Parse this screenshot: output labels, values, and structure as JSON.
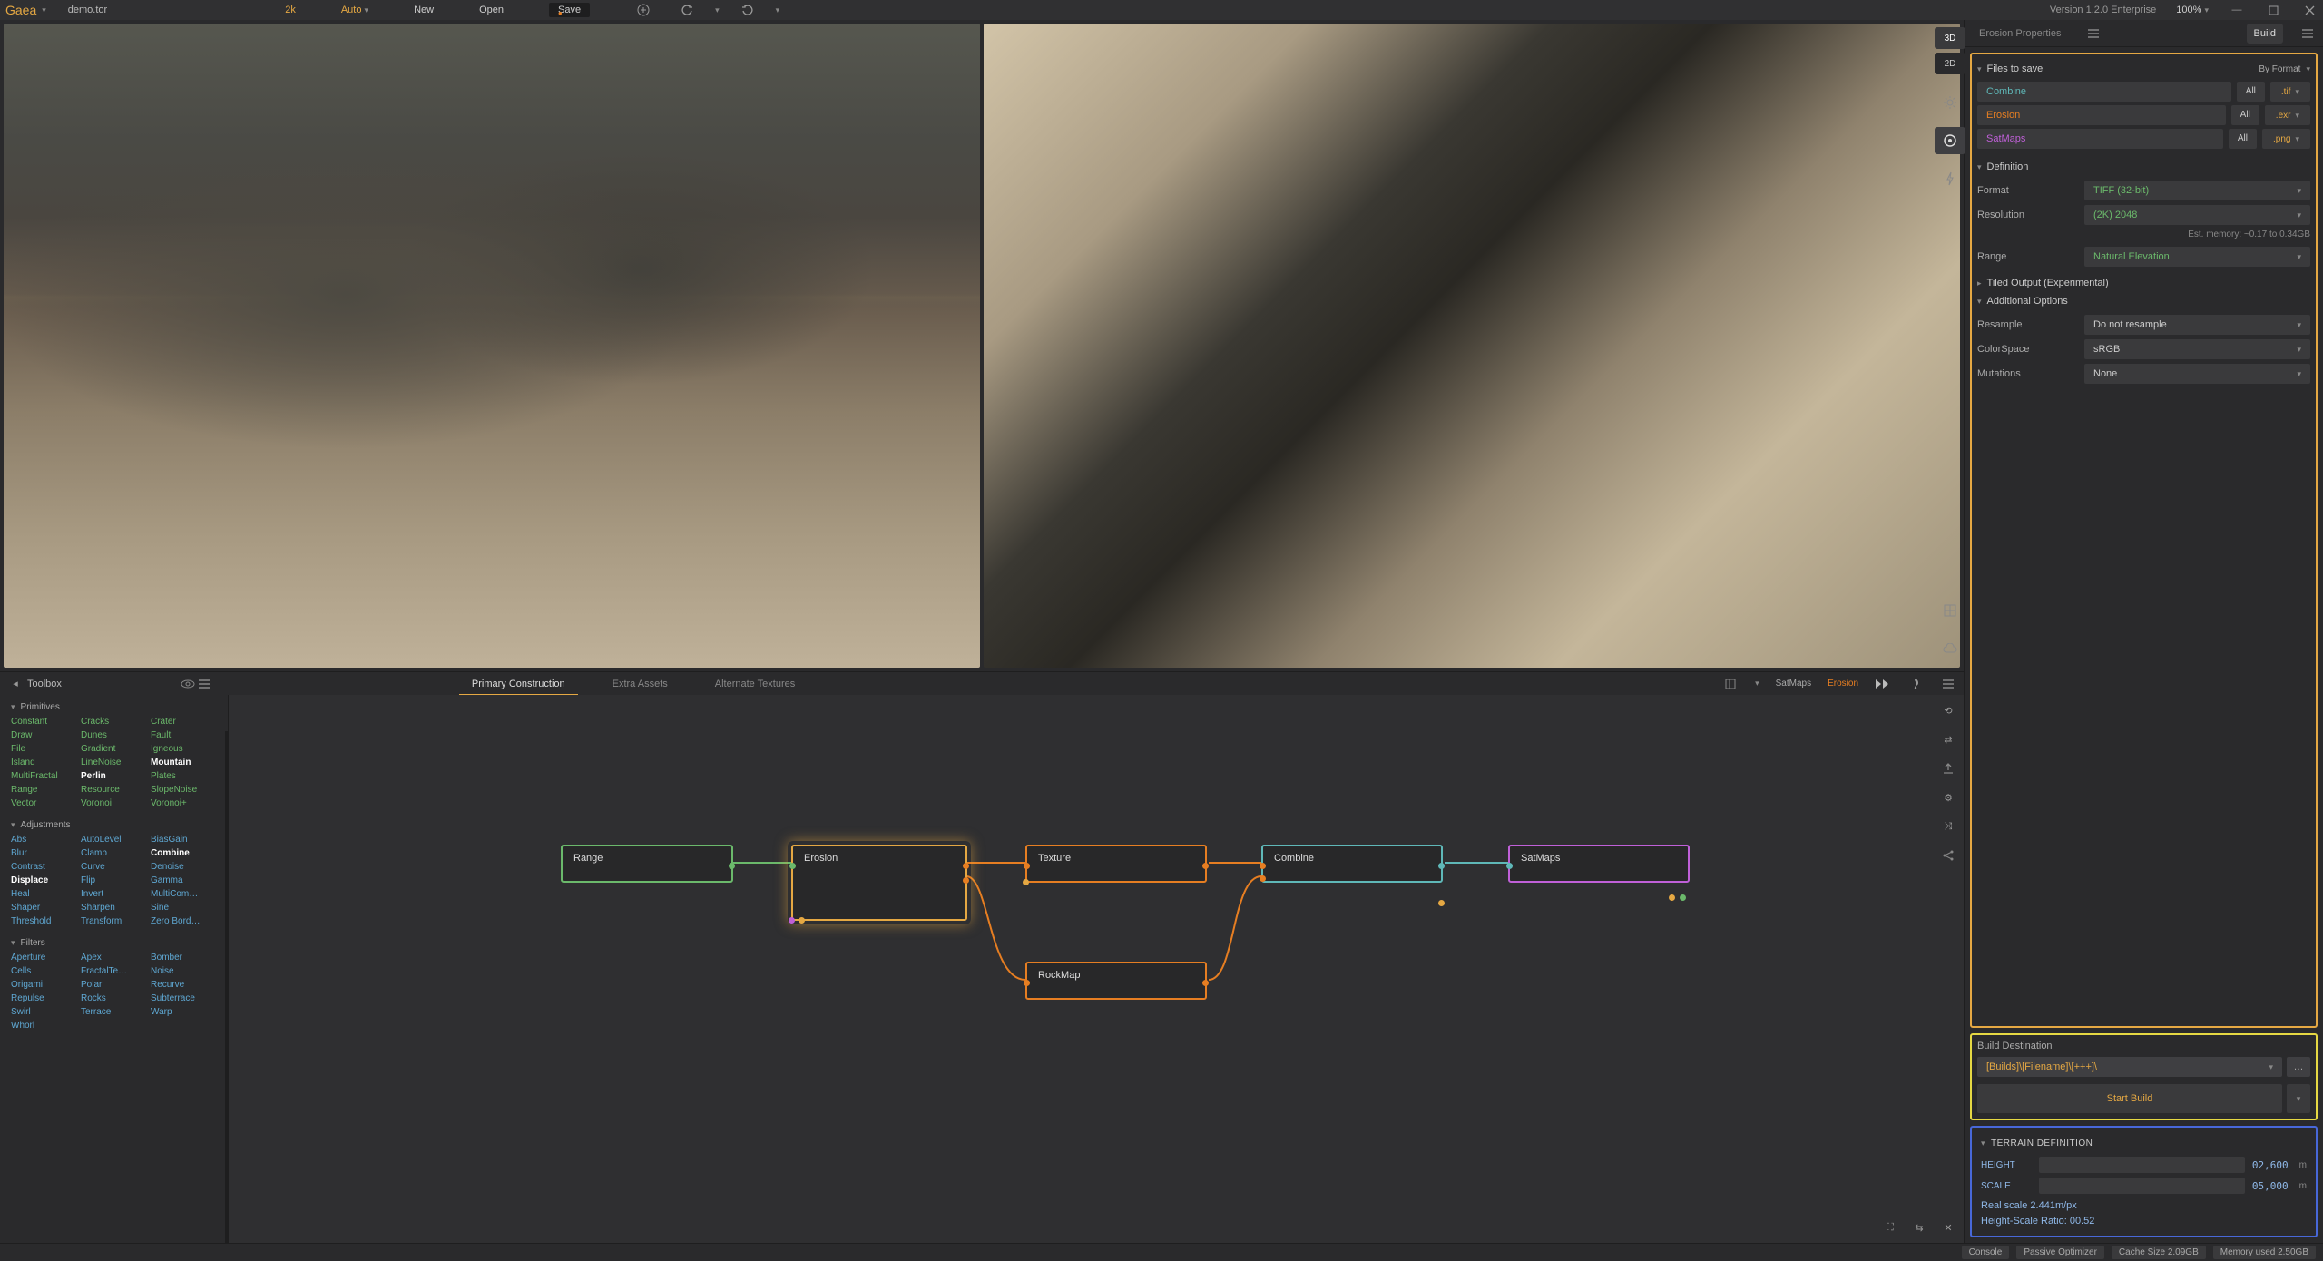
{
  "app": {
    "name": "Gaea",
    "file": "demo.tor",
    "version": "Version 1.2.0 Enterprise",
    "zoom": "100%"
  },
  "toolbar": {
    "res": "2k",
    "auto": "Auto",
    "new": "New",
    "open": "Open",
    "save": "Save"
  },
  "viewport": {
    "mode3d": "3D",
    "mode2d": "2D"
  },
  "graph": {
    "tabs": [
      "Primary Construction",
      "Extra Assets",
      "Alternate Textures"
    ],
    "rightLabels": {
      "sat": "SatMaps",
      "ero": "Erosion"
    }
  },
  "toolbox": {
    "title": "Toolbox",
    "sections": [
      {
        "name": "Primitives",
        "items": [
          {
            "t": "Constant",
            "c": "g"
          },
          {
            "t": "Cracks",
            "c": "g"
          },
          {
            "t": "Crater",
            "c": "g"
          },
          {
            "t": "Draw",
            "c": "g"
          },
          {
            "t": "Dunes",
            "c": "g"
          },
          {
            "t": "Fault",
            "c": "g"
          },
          {
            "t": "File",
            "c": "g"
          },
          {
            "t": "Gradient",
            "c": "g"
          },
          {
            "t": "Igneous",
            "c": "g"
          },
          {
            "t": "Island",
            "c": "g"
          },
          {
            "t": "LineNoise",
            "c": "g"
          },
          {
            "t": "Mountain",
            "c": "g b"
          },
          {
            "t": "MultiFractal",
            "c": "g"
          },
          {
            "t": "Perlin",
            "c": "g b"
          },
          {
            "t": "Plates",
            "c": "g"
          },
          {
            "t": "Range",
            "c": "g"
          },
          {
            "t": "Resource",
            "c": "g"
          },
          {
            "t": "SlopeNoise",
            "c": "g"
          },
          {
            "t": "Vector",
            "c": "g"
          },
          {
            "t": "Voronoi",
            "c": "g"
          },
          {
            "t": "Voronoi+",
            "c": "g"
          }
        ]
      },
      {
        "name": "Adjustments",
        "items": [
          {
            "t": "Abs"
          },
          {
            "t": "AutoLevel"
          },
          {
            "t": "BiasGain"
          },
          {
            "t": "Blur"
          },
          {
            "t": "Clamp"
          },
          {
            "t": "Combine",
            "c": "b"
          },
          {
            "t": "Contrast"
          },
          {
            "t": "Curve"
          },
          {
            "t": "Denoise"
          },
          {
            "t": "Displace",
            "c": "b"
          },
          {
            "t": "Flip"
          },
          {
            "t": "Gamma"
          },
          {
            "t": "Heal"
          },
          {
            "t": "Invert"
          },
          {
            "t": "MultiCom…"
          },
          {
            "t": "Shaper"
          },
          {
            "t": "Sharpen"
          },
          {
            "t": "Sine"
          },
          {
            "t": "Threshold"
          },
          {
            "t": "Transform"
          },
          {
            "t": "Zero Bord…"
          }
        ]
      },
      {
        "name": "Filters",
        "items": [
          {
            "t": "Aperture"
          },
          {
            "t": "Apex"
          },
          {
            "t": "Bomber"
          },
          {
            "t": "Cells"
          },
          {
            "t": "FractalTe…"
          },
          {
            "t": "Noise"
          },
          {
            "t": "Origami"
          },
          {
            "t": "Polar"
          },
          {
            "t": "Recurve"
          },
          {
            "t": "Repulse"
          },
          {
            "t": "Rocks"
          },
          {
            "t": "Subterrace"
          },
          {
            "t": "Swirl"
          },
          {
            "t": "Terrace"
          },
          {
            "t": "Warp"
          },
          {
            "t": "Whorl"
          }
        ]
      }
    ]
  },
  "nodes": {
    "range": "Range",
    "erosion": "Erosion",
    "texture": "Texture",
    "rockmap": "RockMap",
    "combine": "Combine",
    "satmaps": "SatMaps"
  },
  "rightPanel": {
    "tabs": {
      "props": "Erosion Properties",
      "build": "Build"
    },
    "filesToSave": "Files to save",
    "byFormat": "By Format",
    "files": [
      {
        "name": "Combine",
        "color": "#5fb8b8",
        "all": "All",
        "fmt": ".tif"
      },
      {
        "name": "Erosion",
        "color": "#e67e22",
        "all": "All",
        "fmt": ".exr"
      },
      {
        "name": "SatMaps",
        "color": "#c060d8",
        "all": "All",
        "fmt": ".png"
      }
    ],
    "definition": "Definition",
    "format": {
      "label": "Format",
      "val": "TIFF (32-bit)"
    },
    "resolution": {
      "label": "Resolution",
      "val": "(2K) 2048"
    },
    "estmem": "Est. memory:  ~0.17 to 0.34GB",
    "range": {
      "label": "Range",
      "val": "Natural Elevation"
    },
    "tiled": "Tiled Output (Experimental)",
    "additional": "Additional Options",
    "resample": {
      "label": "Resample",
      "val": "Do not resample"
    },
    "colorspace": {
      "label": "ColorSpace",
      "val": "sRGB"
    },
    "mutations": {
      "label": "Mutations",
      "val": "None"
    },
    "buildDest": {
      "label": "Build Destination",
      "path": "[Builds]\\[Filename]\\[+++]\\"
    },
    "startBuild": "Start Build",
    "terrain": {
      "title": "TERRAIN DEFINITION",
      "height": {
        "label": "HEIGHT",
        "val": "02,600",
        "unit": "m"
      },
      "scale": {
        "label": "SCALE",
        "val": "05,000",
        "unit": "m"
      },
      "line1": "Real scale 2.441m/px",
      "line2": "Height-Scale Ratio: 00.52"
    }
  },
  "footer": {
    "console": "Console",
    "passive": "Passive Optimizer",
    "cache": "Cache Size 2.09GB",
    "mem": "Memory used 2.50GB"
  }
}
